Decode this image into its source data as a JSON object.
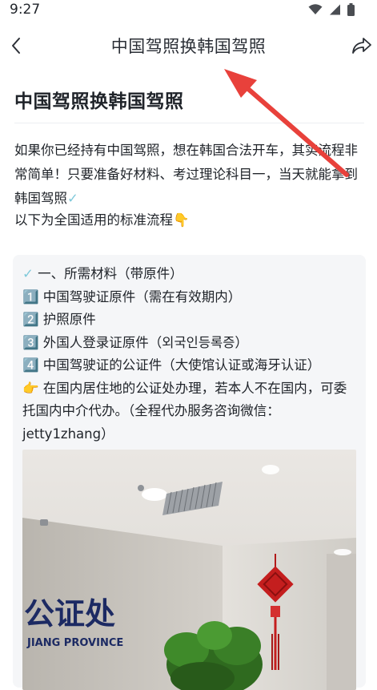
{
  "status": {
    "time": "9:27",
    "icons": [
      "wifi-icon",
      "signal-icon",
      "battery-icon"
    ]
  },
  "topbar": {
    "title": "中国驾照换韩国驾照",
    "back_icon": "chevron-left-icon",
    "share_icon": "share-icon"
  },
  "article": {
    "title": "中国驾照换韩国驾照",
    "intro": "如果你已经持有中国驾照，想在韩国合法开车，其实流程非常简单！只要准备好材料、考过理论科目一，当天就能拿到韩国驾照",
    "intro_emoji": "✓",
    "line2": "以下为全国适用的标准流程",
    "line2_emoji": "👇"
  },
  "card": {
    "heading_emoji": "✓",
    "heading": "一、所需材料（带原件）",
    "items": [
      "1️⃣ 中国驾驶证原件（需在有效期内）",
      "2️⃣ 护照原件",
      "3️⃣ 外国人登录证原件（외국인등록증）",
      "4️⃣ 中国驾驶证的公证件（大使馆认证或海牙认证）"
    ],
    "note_emoji": "👉",
    "note": "在国内居住地的公证处办理，若本人不在国内，可委托国内中介代办。（全程代办服务咨询微信：jetty1zhang）"
  },
  "photo": {
    "sign_text": "公证处",
    "sign_sub": "JIANG PROVINCE"
  },
  "colors": {
    "accent_check": "#7fc9da",
    "arrow": "#e8413b",
    "card_bg": "#f5f6f8"
  }
}
